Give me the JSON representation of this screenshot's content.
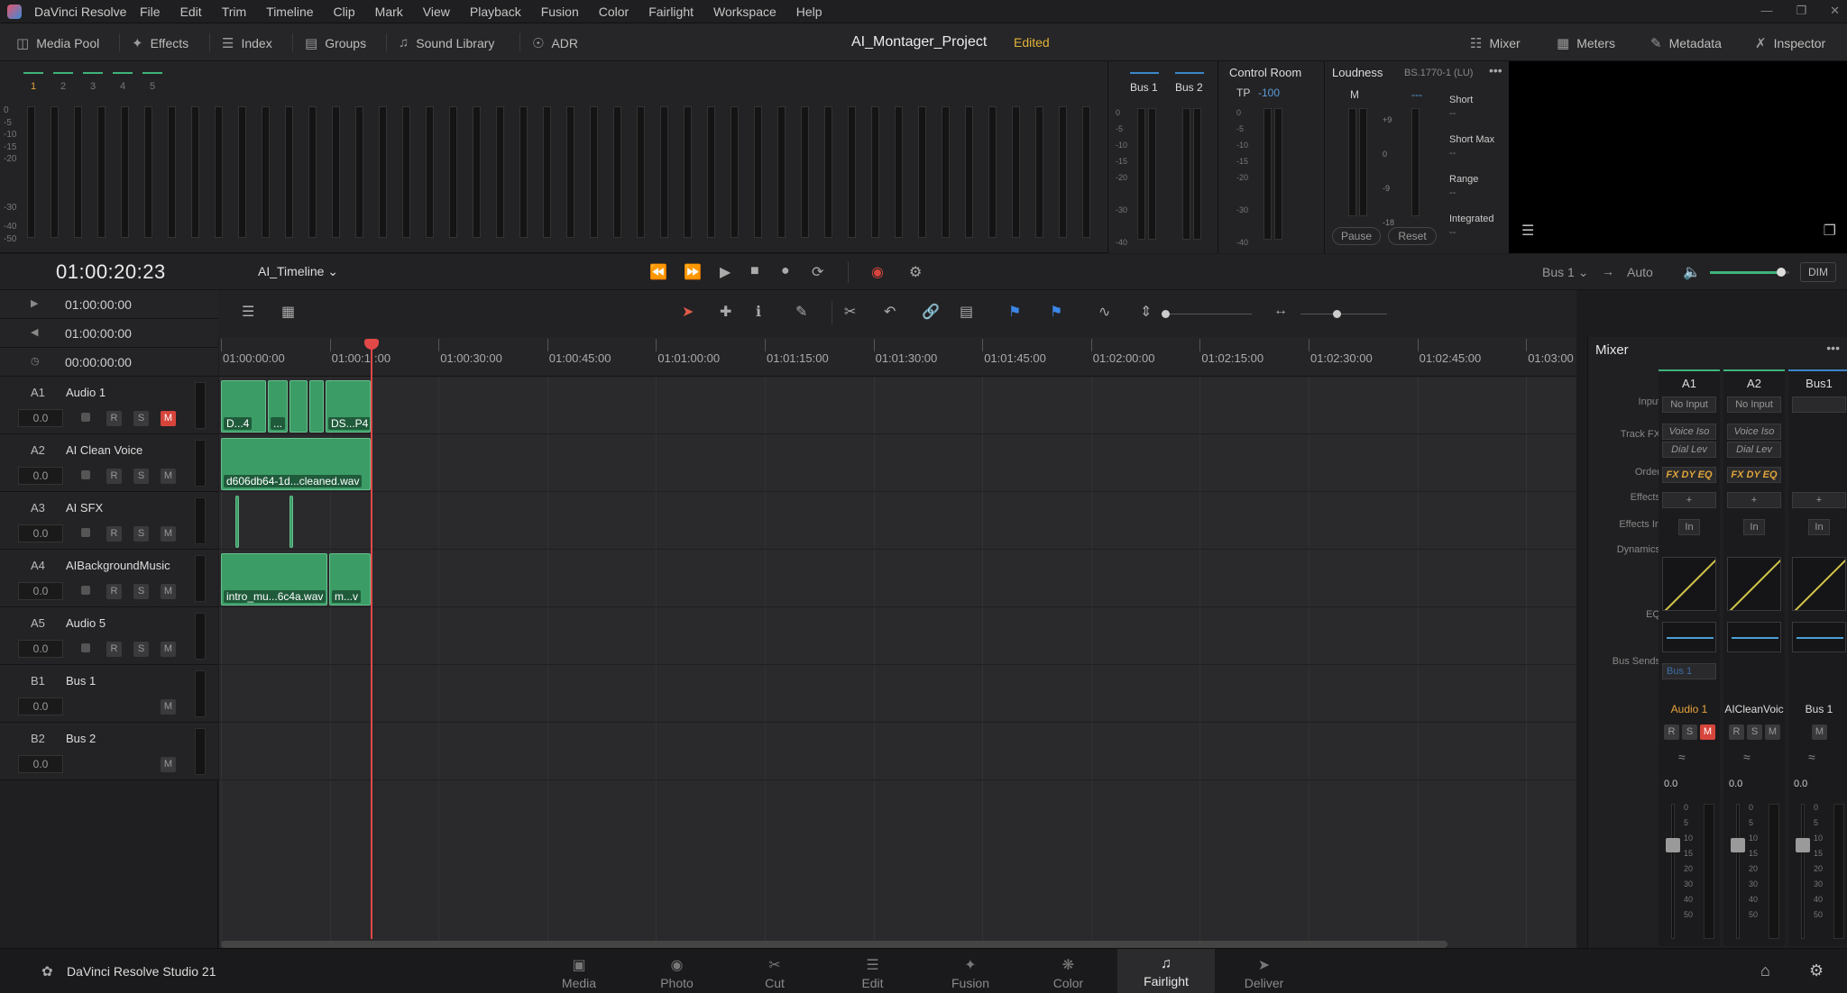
{
  "menubar": {
    "app_name": "DaVinci Resolve",
    "items": [
      "File",
      "Edit",
      "Trim",
      "Timeline",
      "Clip",
      "Mark",
      "View",
      "Playback",
      "Fusion",
      "Color",
      "Fairlight",
      "Workspace",
      "Help"
    ]
  },
  "toolbar": {
    "left": [
      {
        "label": "Media Pool",
        "icon": "media-pool-icon"
      },
      {
        "label": "Effects",
        "icon": "effects-icon"
      },
      {
        "label": "Index",
        "icon": "index-icon"
      },
      {
        "label": "Groups",
        "icon": "groups-icon"
      },
      {
        "label": "Sound Library",
        "icon": "sound-library-icon"
      },
      {
        "label": "ADR",
        "icon": "microphone-icon"
      }
    ],
    "project_name": "AI_Montager_Project",
    "project_status": "Edited",
    "right": [
      {
        "label": "Mixer",
        "icon": "mixer-icon"
      },
      {
        "label": "Meters",
        "icon": "meters-icon"
      },
      {
        "label": "Metadata",
        "icon": "metadata-icon"
      },
      {
        "label": "Inspector",
        "icon": "inspector-icon"
      }
    ]
  },
  "meters": {
    "tabs": [
      "1",
      "2",
      "3",
      "4",
      "5"
    ],
    "scale": [
      "0",
      "-5",
      "-10",
      "-15",
      "-20",
      "-30",
      "-40",
      "-50"
    ],
    "bus_labels": [
      "Bus 1",
      "Bus 2"
    ]
  },
  "control_room": {
    "title": "Control Room",
    "tp_label": "TP",
    "tp_value": "-100"
  },
  "loudness": {
    "title": "Loudness",
    "standard": "BS.1770-1 (LU)",
    "m_label": "M",
    "m_value": "---",
    "scale": [
      "+9",
      "0",
      "-9",
      "-18"
    ],
    "stats": [
      {
        "label": "Short",
        "value": "--"
      },
      {
        "label": "Short Max",
        "value": "--"
      },
      {
        "label": "Range",
        "value": "--"
      },
      {
        "label": "Integrated",
        "value": "--"
      }
    ],
    "pause": "Pause",
    "reset": "Reset"
  },
  "transport": {
    "timecode": "01:00:20:23",
    "timeline_name": "AI_Timeline",
    "bus_select": "Bus 1",
    "auto": "Auto",
    "dim": "DIM",
    "volume_level": 0.9
  },
  "timecodes": {
    "in": "01:00:00:00",
    "out": "01:00:00:00",
    "duration": "00:00:00:00"
  },
  "tracks": [
    {
      "id": "A1",
      "name": "Audio 1",
      "vol": "0.0",
      "mute_on": true,
      "has_rs": true
    },
    {
      "id": "A2",
      "name": "AI Clean Voice",
      "vol": "0.0",
      "mute_on": false,
      "has_rs": true
    },
    {
      "id": "A3",
      "name": "AI SFX",
      "vol": "0.0",
      "mute_on": false,
      "has_rs": true
    },
    {
      "id": "A4",
      "name": "AIBackgroundMusic",
      "vol": "0.0",
      "mute_on": false,
      "has_rs": true
    },
    {
      "id": "A5",
      "name": "Audio 5",
      "vol": "0.0",
      "mute_on": false,
      "has_rs": true
    },
    {
      "id": "B1",
      "name": "Bus 1",
      "vol": "0.0",
      "mute_on": false,
      "has_rs": false
    },
    {
      "id": "B2",
      "name": "Bus 2",
      "vol": "0.0",
      "mute_on": false,
      "has_rs": false
    }
  ],
  "buttons": {
    "r": "R",
    "s": "S",
    "m": "M"
  },
  "ruler": [
    "01:00:00:00",
    "01:00:1",
    "01:00:30:00",
    "01:00:45:00",
    "01:01:00:00",
    "01:01:15:00",
    "01:01:30:00",
    "01:01:45:00",
    "01:02:00:00",
    "01:02:15:00",
    "01:02:30:00",
    "01:02:45:00",
    "01:03:00"
  ],
  "ruler_playhead_text": ":00",
  "clips": {
    "a1_first": "D...4",
    "a1_mid": "...",
    "a1_last": "DS...P4",
    "a2": "d606db64-1d...cleaned.wav",
    "a4_first": "intro_mu...6c4a.wav",
    "a4_second": "m...v"
  },
  "mixer": {
    "title": "Mixer",
    "row_labels": [
      "Input",
      "Track FX",
      "Order",
      "Effects",
      "Effects In",
      "Dynamics",
      "EQ",
      "Bus Sends"
    ],
    "columns": [
      {
        "id": "A1",
        "input": "No Input",
        "fx": [
          "Voice Iso",
          "Dial Lev"
        ],
        "order": "FX DY EQ",
        "bus_send": "Bus 1",
        "name": "Audio 1",
        "gain": "0.0"
      },
      {
        "id": "A2",
        "input": "No Input",
        "fx": [
          "Voice Iso",
          "Dial Lev"
        ],
        "order": "FX DY EQ",
        "bus_send": "",
        "name": "AICleanVoic",
        "gain": "0.0"
      },
      {
        "id": "Bus1",
        "input": "",
        "fx": [],
        "order": "",
        "bus_send": "",
        "name": "Bus 1",
        "gain": "0.0"
      }
    ],
    "effects_add": "+",
    "effects_in": "In",
    "fader_scale": [
      "0",
      "5",
      "10",
      "15",
      "20",
      "30",
      "40",
      "50"
    ]
  },
  "footer": {
    "brand": "DaVinci Resolve Studio 21",
    "pages": [
      {
        "label": "Media",
        "icon": "media-page-icon"
      },
      {
        "label": "Photo",
        "icon": "photo-page-icon"
      },
      {
        "label": "Cut",
        "icon": "cut-page-icon"
      },
      {
        "label": "Edit",
        "icon": "edit-page-icon"
      },
      {
        "label": "Fusion",
        "icon": "fusion-page-icon"
      },
      {
        "label": "Color",
        "icon": "color-page-icon"
      },
      {
        "label": "Fairlight",
        "icon": "fairlight-page-icon"
      },
      {
        "label": "Deliver",
        "icon": "deliver-page-icon"
      }
    ],
    "active_page": "Fairlight"
  }
}
